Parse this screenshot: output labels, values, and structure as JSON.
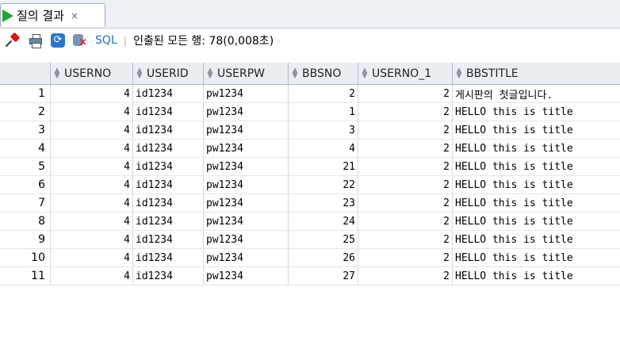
{
  "tab": {
    "label": "질의 결과",
    "close": "×"
  },
  "toolbar": {
    "sql_label": "SQL",
    "separator": "|",
    "status": "인출된 모든 행: 78(0,008초)"
  },
  "icons": {
    "run": "play-icon",
    "pin": "pin-icon",
    "print": "printer-icon",
    "refresh": "refresh-icon",
    "cancel": "cancel-query-icon",
    "sort": "sort-arrows-icon"
  },
  "colors": {
    "run_green": "#24a33c",
    "sql_link": "#1d6fd0",
    "header_bg": "#eaedf2"
  },
  "columns": [
    "USERNO",
    "USERID",
    "USERPW",
    "BBSNO",
    "USERNO_1",
    "BBSTITLE"
  ],
  "rows": [
    {
      "n": "1",
      "USERNO": "4",
      "USERID": "id1234",
      "USERPW": "pw1234",
      "BBSNO": "2",
      "USERNO_1": "2",
      "BBSTITLE": "게시판의 첫글입니다."
    },
    {
      "n": "2",
      "USERNO": "4",
      "USERID": "id1234",
      "USERPW": "pw1234",
      "BBSNO": "1",
      "USERNO_1": "2",
      "BBSTITLE": "HELLO this is title"
    },
    {
      "n": "3",
      "USERNO": "4",
      "USERID": "id1234",
      "USERPW": "pw1234",
      "BBSNO": "3",
      "USERNO_1": "2",
      "BBSTITLE": "HELLO this is title"
    },
    {
      "n": "4",
      "USERNO": "4",
      "USERID": "id1234",
      "USERPW": "pw1234",
      "BBSNO": "4",
      "USERNO_1": "2",
      "BBSTITLE": "HELLO this is title"
    },
    {
      "n": "5",
      "USERNO": "4",
      "USERID": "id1234",
      "USERPW": "pw1234",
      "BBSNO": "21",
      "USERNO_1": "2",
      "BBSTITLE": "HELLO this is title"
    },
    {
      "n": "6",
      "USERNO": "4",
      "USERID": "id1234",
      "USERPW": "pw1234",
      "BBSNO": "22",
      "USERNO_1": "2",
      "BBSTITLE": "HELLO this is title"
    },
    {
      "n": "7",
      "USERNO": "4",
      "USERID": "id1234",
      "USERPW": "pw1234",
      "BBSNO": "23",
      "USERNO_1": "2",
      "BBSTITLE": "HELLO this is title"
    },
    {
      "n": "8",
      "USERNO": "4",
      "USERID": "id1234",
      "USERPW": "pw1234",
      "BBSNO": "24",
      "USERNO_1": "2",
      "BBSTITLE": "HELLO this is title"
    },
    {
      "n": "9",
      "USERNO": "4",
      "USERID": "id1234",
      "USERPW": "pw1234",
      "BBSNO": "25",
      "USERNO_1": "2",
      "BBSTITLE": "HELLO this is title"
    },
    {
      "n": "10",
      "USERNO": "4",
      "USERID": "id1234",
      "USERPW": "pw1234",
      "BBSNO": "26",
      "USERNO_1": "2",
      "BBSTITLE": "HELLO this is title"
    },
    {
      "n": "11",
      "USERNO": "4",
      "USERID": "id1234",
      "USERPW": "pw1234",
      "BBSNO": "27",
      "USERNO_1": "2",
      "BBSTITLE": "HELLO this is title"
    }
  ]
}
